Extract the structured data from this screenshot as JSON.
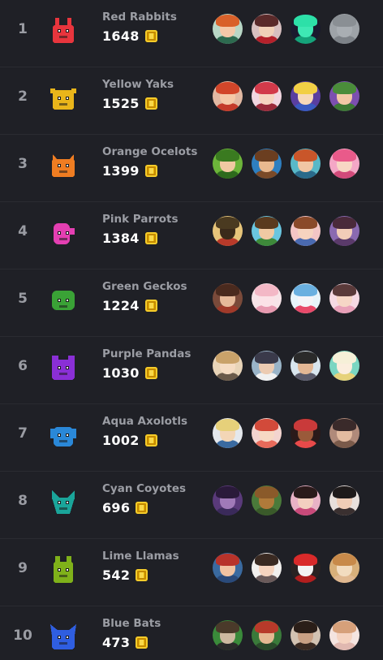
{
  "leaderboard": [
    {
      "rank": "1",
      "name": "Red Rabbits",
      "score": "1648",
      "color": "#e8353d",
      "icon": "rabbit-icon",
      "members": [
        {
          "bg": "#b9d7c6",
          "hair": "#d9612a",
          "face": "#f4c8a8",
          "body": "#2d6a4f",
          "icon": "avatar-icon"
        },
        {
          "bg": "#d8c0c0",
          "hair": "#5a2a2a",
          "face": "#f0d0b8",
          "body": "#b5212b",
          "icon": "avatar-icon"
        },
        {
          "bg": "#1a1a2e",
          "hair": "#2de0a8",
          "face": "#3ee8b4",
          "body": "#15a37a",
          "icon": "avatar-icon"
        },
        {
          "bg": "#9ea3a8",
          "hair": "#8a8f94",
          "face": "#a9aeb3",
          "body": "#7d8288",
          "icon": "avatar-icon"
        }
      ]
    },
    {
      "rank": "2",
      "name": "Yellow Yaks",
      "score": "1525",
      "color": "#e9b51a",
      "icon": "yak-icon",
      "members": [
        {
          "bg": "#e2b9a3",
          "hair": "#d2462a",
          "face": "#f5c9a8",
          "body": "#c43a2a",
          "icon": "avatar-icon"
        },
        {
          "bg": "#f1d6e0",
          "hair": "#d23a4a",
          "face": "#f6d4c0",
          "body": "#9a2a3a",
          "icon": "avatar-icon"
        },
        {
          "bg": "#5a3ea0",
          "hair": "#f2cf45",
          "face": "#f7d9b9",
          "body": "#3a5ac0",
          "icon": "avatar-icon"
        },
        {
          "bg": "#7c4fb0",
          "hair": "#4a8c3a",
          "face": "#f2c8a5",
          "body": "#3d7a34",
          "icon": "avatar-icon"
        }
      ]
    },
    {
      "rank": "3",
      "name": "Orange Ocelots",
      "score": "1399",
      "color": "#ef7d22",
      "icon": "ocelot-icon",
      "members": [
        {
          "bg": "#6cb43a",
          "hair": "#3a7a20",
          "face": "#f1c9a2",
          "body": "#2d6a1c",
          "icon": "avatar-icon"
        },
        {
          "bg": "#2e7fc0",
          "hair": "#6b3e20",
          "face": "#e9b98f",
          "body": "#7a4a28",
          "icon": "avatar-icon"
        },
        {
          "bg": "#58b8c8",
          "hair": "#c9562a",
          "face": "#f1c6a4",
          "body": "#2a6a8a",
          "icon": "avatar-icon"
        },
        {
          "bg": "#f4a7c6",
          "hair": "#e95a8a",
          "face": "#f8d6c4",
          "body": "#d24a7a",
          "icon": "avatar-icon"
        }
      ]
    },
    {
      "rank": "4",
      "name": "Pink Parrots",
      "score": "1384",
      "color": "#e43fb2",
      "icon": "parrot-icon",
      "members": [
        {
          "bg": "#e6c47a",
          "hair": "#4a3a20",
          "face": "#3a2a1a",
          "body": "#b83a2a",
          "icon": "avatar-icon"
        },
        {
          "bg": "#6ac6e0",
          "hair": "#5a3a1e",
          "face": "#f0c9a3",
          "body": "#3e8a3a",
          "icon": "avatar-icon"
        },
        {
          "bg": "#f3c5c5",
          "hair": "#8a4a2a",
          "face": "#f6d3bf",
          "body": "#4a6ab0",
          "icon": "avatar-icon"
        },
        {
          "bg": "#8a6ab0",
          "hair": "#4a2a3a",
          "face": "#f2cdb8",
          "body": "#5a3a6a",
          "icon": "avatar-icon"
        }
      ]
    },
    {
      "rank": "5",
      "name": "Green Geckos",
      "score": "1224",
      "color": "#3aa236",
      "icon": "gecko-icon",
      "members": [
        {
          "bg": "#7a4a3a",
          "hair": "#4a2a1e",
          "face": "#e6b99a",
          "body": "#a03a2a",
          "icon": "avatar-icon"
        },
        {
          "bg": "#f7e4e8",
          "hair": "#f3b8c6",
          "face": "#fbe2e7",
          "body": "#e79ab0",
          "icon": "avatar-icon"
        },
        {
          "bg": "#e8f4fa",
          "hair": "#6ab0e0",
          "face": "#f4f4f8",
          "body": "#e84a6a",
          "icon": "avatar-icon"
        },
        {
          "bg": "#f5d9e3",
          "hair": "#5a3a3a",
          "face": "#f6d6c6",
          "body": "#e8a0b8",
          "icon": "avatar-icon"
        }
      ]
    },
    {
      "rank": "6",
      "name": "Purple Pandas",
      "score": "1030",
      "color": "#8a2fd6",
      "icon": "panda-icon",
      "members": [
        {
          "bg": "#e8d4b8",
          "hair": "#c9a26a",
          "face": "#f5dcc3",
          "body": "#6a5a4a",
          "icon": "avatar-icon"
        },
        {
          "bg": "#9ab4c8",
          "hair": "#3a3a4a",
          "face": "#eccbb2",
          "body": "#f0f0f0",
          "icon": "avatar-icon"
        },
        {
          "bg": "#d9e6ee",
          "hair": "#2a2a2a",
          "face": "#e3b794",
          "body": "#5a5a6a",
          "icon": "avatar-icon"
        },
        {
          "bg": "#7ad6c2",
          "hair": "#f6f0d8",
          "face": "#fbeede",
          "body": "#e6d27a",
          "icon": "avatar-icon"
        }
      ]
    },
    {
      "rank": "7",
      "name": "Aqua Axolotls",
      "score": "1002",
      "color": "#2a88d8",
      "icon": "axolotl-icon",
      "members": [
        {
          "bg": "#e4e8ec",
          "hair": "#e6d07a",
          "face": "#f3d6b6",
          "body": "#3a6aa0",
          "icon": "avatar-icon"
        },
        {
          "bg": "#f3d4cf",
          "hair": "#d24a3a",
          "face": "#f7d9c4",
          "body": "#e86a5a",
          "icon": "avatar-icon"
        },
        {
          "bg": "#2a1a1a",
          "hair": "#c93a3a",
          "face": "#9a5a3a",
          "body": "#e84a4a",
          "icon": "avatar-icon"
        },
        {
          "bg": "#b08a7a",
          "hair": "#3a2a2a",
          "face": "#e3bba0",
          "body": "#7a5a4a",
          "icon": "avatar-icon"
        }
      ]
    },
    {
      "rank": "8",
      "name": "Cyan Coyotes",
      "score": "696",
      "color": "#1aa59a",
      "icon": "coyote-icon",
      "members": [
        {
          "bg": "#5a3a7a",
          "hair": "#2a1a3a",
          "face": "#a07ab8",
          "body": "#3a2a5a",
          "icon": "avatar-icon"
        },
        {
          "bg": "#4a7a3a",
          "hair": "#8a5a2a",
          "face": "#b07a3a",
          "body": "#3a5a2a",
          "icon": "avatar-icon"
        },
        {
          "bg": "#e8b2c6",
          "hair": "#2a1a1a",
          "face": "#f3cfc0",
          "body": "#c84a7a",
          "icon": "avatar-icon"
        },
        {
          "bg": "#e8e0dc",
          "hair": "#1e1a1a",
          "face": "#f0cdb6",
          "body": "#3a3030",
          "icon": "avatar-icon"
        }
      ]
    },
    {
      "rank": "9",
      "name": "Lime Llamas",
      "score": "542",
      "color": "#7fb11a",
      "icon": "llama-icon",
      "members": [
        {
          "bg": "#3a6aa0",
          "hair": "#b8332a",
          "face": "#f1c3a2",
          "body": "#2a4a7a",
          "icon": "avatar-icon"
        },
        {
          "bg": "#f2f0ee",
          "hair": "#3a2a22",
          "face": "#f6d4bf",
          "body": "#6a5a5a",
          "icon": "avatar-icon"
        },
        {
          "bg": "#2a2222",
          "hair": "#d92a2a",
          "face": "#f3f3f3",
          "body": "#b21e1e",
          "icon": "avatar-icon"
        },
        {
          "bg": "#d8b07a",
          "hair": "#c88a4a",
          "face": "#f2dcc0",
          "body": "#e0b890",
          "icon": "avatar-icon"
        }
      ]
    },
    {
      "rank": "10",
      "name": "Blue Bats",
      "score": "473",
      "color": "#2f5ee0",
      "icon": "bat-icon",
      "members": [
        {
          "bg": "#3a8a3a",
          "hair": "#4a3a2a",
          "face": "#cdb9a0",
          "body": "#2a2a2a",
          "icon": "avatar-icon"
        },
        {
          "bg": "#3a7a3a",
          "hair": "#b83a2a",
          "face": "#e6b892",
          "body": "#2a4a2a",
          "icon": "avatar-icon"
        },
        {
          "bg": "#d2c2b2",
          "hair": "#2a1e18",
          "face": "#c9a084",
          "body": "#3a2a22",
          "icon": "avatar-icon"
        },
        {
          "bg": "#f4e4e0",
          "hair": "#d6a07a",
          "face": "#f5d3c0",
          "body": "#e0b8b0",
          "icon": "avatar-icon"
        }
      ]
    }
  ]
}
